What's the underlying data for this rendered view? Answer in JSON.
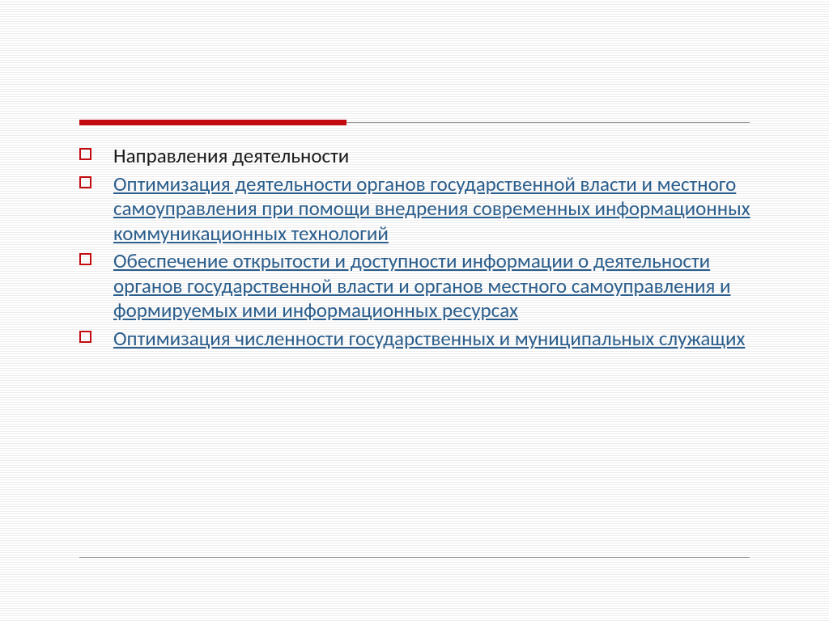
{
  "colors": {
    "accent": "#c30a0e",
    "link": "#2b5e8c",
    "rule": "#9b9b9b"
  },
  "items": [
    {
      "text": "Направления деятельности",
      "link": false
    },
    {
      "text": "Оптимизация деятельности органов государственной власти и местного самоуправления при помощи внедрения современных информационных коммуникационных технологий",
      "link": true
    },
    {
      "text": "Обеспечение открытости и доступности информации о деятельности органов государственной власти и органов местного самоуправления и формируемых ими информационных ресурсах",
      "link": true
    },
    {
      "text": "Оптимизация численности государственных и муниципальных служащих",
      "link": true
    }
  ]
}
